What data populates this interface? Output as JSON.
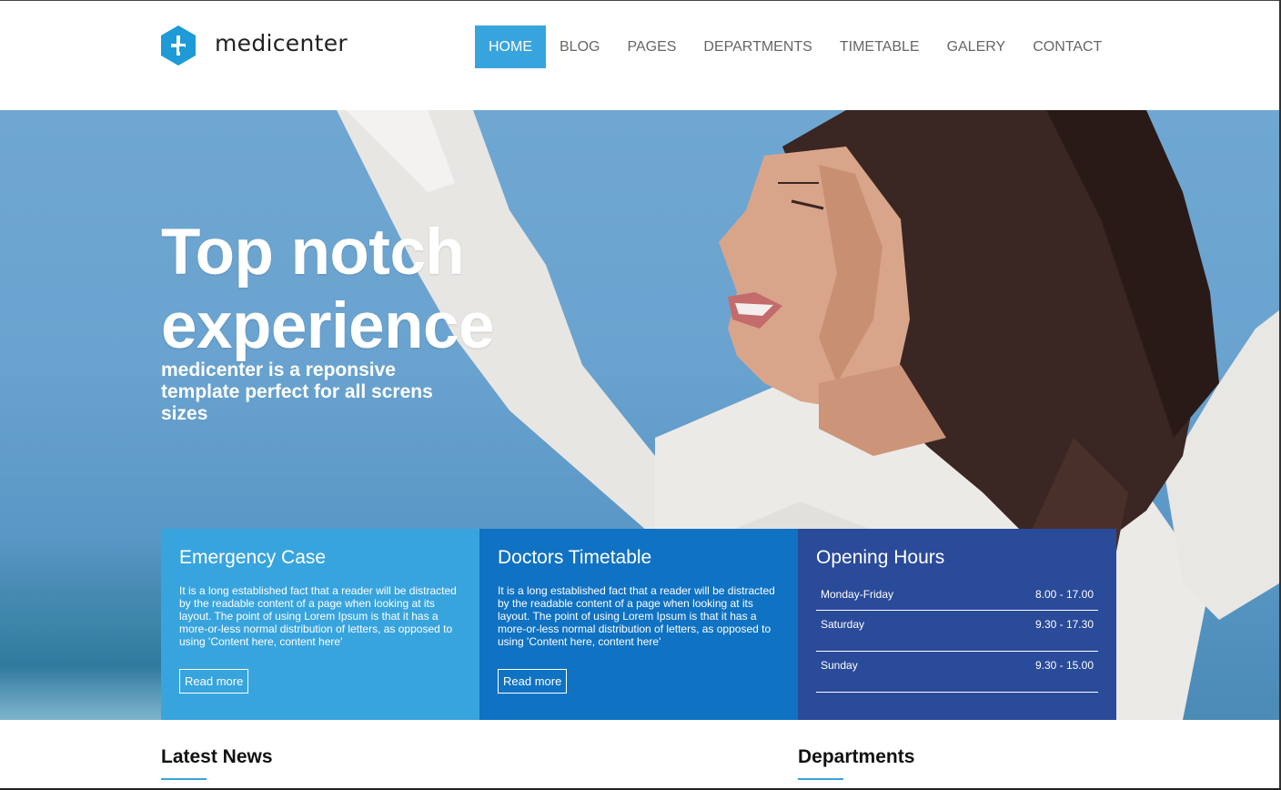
{
  "brand": {
    "name": "medicenter",
    "accent": "#38a4de"
  },
  "nav": [
    {
      "label": "HOME",
      "active": true
    },
    {
      "label": "BLOG"
    },
    {
      "label": "PAGES"
    },
    {
      "label": "DEPARTMENTS"
    },
    {
      "label": "TIMETABLE"
    },
    {
      "label": "GALERY"
    },
    {
      "label": "CONTACT"
    }
  ],
  "hero": {
    "title_line1": "Top notch",
    "title_line2": "experience",
    "subtitle": "medicenter is a reponsive template perfect for all screns sizes"
  },
  "boxes": {
    "emergency": {
      "title": "Emergency Case",
      "text": "It is a long established fact that a reader will be distracted by the readable content of a page when looking at its layout. The point of using Lorem Ipsum is that it has a more-or-less normal distribution of letters, as opposed to using 'Content here, content here'",
      "button": "Read more",
      "color": "#38a4de"
    },
    "timetable": {
      "title": "Doctors Timetable",
      "text": "It is a long established fact that a reader will be distracted by the readable content of a page when looking at its layout. The point of using Lorem Ipsum is that it has a more-or-less normal distribution of letters, as opposed to using 'Content here, content here'",
      "button": "Read more",
      "color": "#0f72c3"
    },
    "hours": {
      "title": "Opening Hours",
      "rows": [
        {
          "day": "Monday-Friday",
          "time": "8.00 - 17.00"
        },
        {
          "day": "Saturday",
          "time": "9.30 - 17.30"
        },
        {
          "day": "Sunday",
          "time": "9.30 - 15.00"
        }
      ],
      "color": "#2a4a9a"
    }
  },
  "sections": {
    "latest_news": "Latest News",
    "departments": "Departments"
  }
}
